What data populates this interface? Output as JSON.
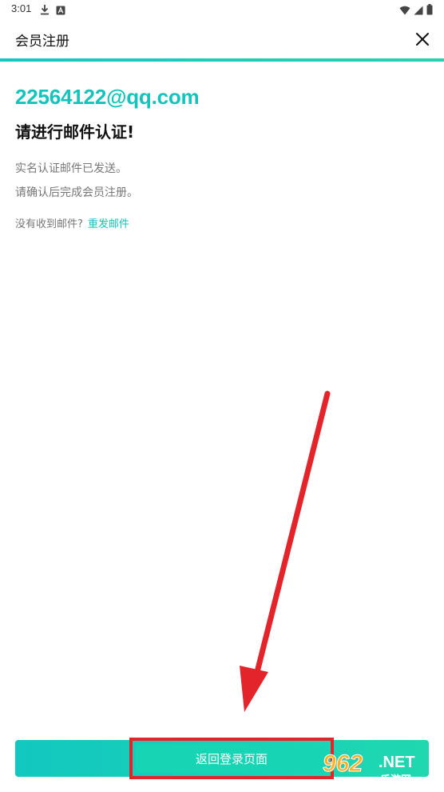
{
  "status_bar": {
    "time": "3:01",
    "icons": [
      "download-icon",
      "notification-a-icon",
      "wifi-icon",
      "signal-icon",
      "battery-icon"
    ]
  },
  "app_bar": {
    "title": "会员注册",
    "close_icon": "close-icon"
  },
  "content": {
    "email": "22564122@qq.com",
    "headline": "请进行邮件认证!",
    "desc_line1": "实名认证邮件已发送。",
    "desc_line2": "请确认后完成会员注册。",
    "not_received": "没有收到邮件?",
    "resend_link": "重发邮件"
  },
  "footer": {
    "back_to_login": "返回登录页面"
  },
  "watermark": {
    "number": "962",
    "net": ".NET",
    "site_name": "乐游网"
  },
  "colors": {
    "accent": "#14c4bb",
    "button": "#17d4b5",
    "annotation_red": "#e3242b"
  }
}
